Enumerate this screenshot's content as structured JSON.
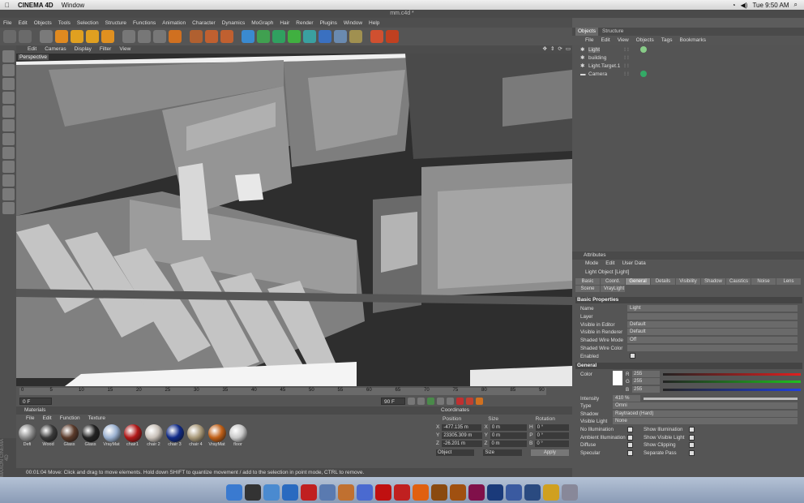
{
  "mac_menu": {
    "app": "CINEMA 4D",
    "items": [
      "Window"
    ],
    "clock": "Tue 9:50 AM"
  },
  "window_title": "mm.c4d *",
  "menubar": [
    "File",
    "Edit",
    "Objects",
    "Tools",
    "Selection",
    "Structure",
    "Functions",
    "Animation",
    "Character",
    "Dynamics",
    "MoGraph",
    "Hair",
    "Render",
    "Plugins",
    "Window",
    "Help"
  ],
  "toolbar_icons": [
    "undo-icon",
    "redo-icon",
    "live-select-icon",
    "move-icon",
    "scale-icon",
    "rotate-icon",
    "world-axis-icon",
    "x-axis-icon",
    "y-axis-icon",
    "z-axis-icon",
    "coordinate-system-icon",
    "render-view-icon",
    "render-picture-viewer-icon",
    "render-settings-icon",
    "cube-icon",
    "nurbs-icon",
    "array-icon",
    "deformer-icon",
    "scene-icon",
    "floor-icon",
    "camera-icon",
    "light-icon",
    "brush-icon",
    "record-icon"
  ],
  "viewport": {
    "menu": [
      "Edit",
      "Cameras",
      "Display",
      "Filter",
      "View"
    ],
    "label": "Perspective"
  },
  "timeline": {
    "ticks": [
      "0",
      "5",
      "10",
      "15",
      "20",
      "25",
      "30",
      "35",
      "40",
      "45",
      "50",
      "55",
      "60",
      "65",
      "70",
      "75",
      "80",
      "85",
      "90"
    ],
    "start": "0 F",
    "end": "90 F",
    "current": "0 F",
    "min_field": "0 F"
  },
  "materials": {
    "title": "Materials",
    "menu": [
      "File",
      "Edit",
      "Function",
      "Texture"
    ],
    "items": [
      {
        "name": "Defi",
        "color": "#8a8a8a"
      },
      {
        "name": "Wood",
        "color": "#3a3a3a"
      },
      {
        "name": "Glass",
        "color": "#5a3a2a"
      },
      {
        "name": "Glass",
        "color": "#222"
      },
      {
        "name": "VrayMat",
        "color": "#9ab0d0"
      },
      {
        "name": "chair1",
        "color": "#b01818"
      },
      {
        "name": "chair 2",
        "color": "#c8c0b8"
      },
      {
        "name": "chair 3",
        "color": "#102a88"
      },
      {
        "name": "chair 4",
        "color": "#a89878"
      },
      {
        "name": "VrayMat",
        "color": "#c06018"
      },
      {
        "name": "floor",
        "color": "#c8c8c8"
      }
    ]
  },
  "coordinates": {
    "title": "Coordinates",
    "headers": [
      "Position",
      "Size",
      "Rotation"
    ],
    "rows": [
      {
        "axis": "X",
        "pos": "-477.135 m",
        "size_axis": "X",
        "size": "0 m",
        "rot_axis": "H",
        "rot": "0 °"
      },
      {
        "axis": "Y",
        "pos": "23305.309 m",
        "size_axis": "Y",
        "size": "0 m",
        "rot_axis": "P",
        "rot": "0 °"
      },
      {
        "axis": "Z",
        "pos": "-26.201 m",
        "size_axis": "Z",
        "size": "0 m",
        "rot_axis": "B",
        "rot": "0 °"
      }
    ],
    "mode": "Object",
    "size_mode": "Size",
    "apply": "Apply"
  },
  "status": "00:01:04  Move: Click and drag to move elements. Hold down SHIFT to quantize movement / add to the selection in point mode, CTRL to remove.",
  "brand": "MAXON CINEMA 4D",
  "objects": {
    "tabs": [
      "Objects",
      "Structure"
    ],
    "menu": [
      "File",
      "Edit",
      "View",
      "Objects",
      "Tags",
      "Bookmarks"
    ],
    "list": [
      {
        "name": "Light",
        "indent": 0,
        "selected": true
      },
      {
        "name": "building",
        "indent": 0,
        "selected": false
      },
      {
        "name": "Light.Target.1",
        "indent": 0,
        "selected": false
      },
      {
        "name": "Camera",
        "indent": 0,
        "selected": false
      }
    ]
  },
  "attributes": {
    "title": "Attributes",
    "menu": [
      "Mode",
      "Edit",
      "User Data"
    ],
    "object_title": "Light Object [Light]",
    "tabs": [
      "Basic",
      "Coord.",
      "General",
      "Details",
      "Visibility",
      "Shadow",
      "Caustics",
      "Noise",
      "Lens",
      "Scene",
      "VrayLight"
    ],
    "active_tab": "General",
    "basic_title": "Basic Properties",
    "basic": [
      {
        "label": "Name",
        "value": "Light"
      },
      {
        "label": "Layer",
        "value": ""
      },
      {
        "label": "Visible in Editor",
        "value": "Default"
      },
      {
        "label": "Visible in Renderer",
        "value": "Default"
      },
      {
        "label": "Shaded Wire Mode",
        "value": "Off"
      },
      {
        "label": "Shaded Wire Color",
        "value": ""
      },
      {
        "label": "Enabled",
        "value": ""
      }
    ],
    "general_title": "General",
    "color_label": "Color",
    "rgb": [
      {
        "ch": "R",
        "val": "255"
      },
      {
        "ch": "G",
        "val": "255"
      },
      {
        "ch": "B",
        "val": "255"
      }
    ],
    "general": [
      {
        "label": "Intensity",
        "value": "410 %"
      },
      {
        "label": "Type",
        "value": "Omni"
      },
      {
        "label": "Shadow",
        "value": "Raytraced (Hard)"
      },
      {
        "label": "Visible Light",
        "value": "None"
      }
    ],
    "checks_left": [
      "No Illumination",
      "Ambient Illumination",
      "Diffuse",
      "Specular"
    ],
    "checks_right": [
      "Show Illumination",
      "Show Visible Light",
      "Show Clipping",
      "Separate Pass"
    ]
  },
  "dock": [
    "Finder",
    "Dashboard",
    "Mail",
    "Safari",
    "iCal",
    "Preview",
    "Photo",
    "iTunes",
    "Flash",
    "Acrobat",
    "Firefox",
    "Bridge",
    "Illustrator",
    "InDesign",
    "Photoshop",
    "Keyboard",
    "Sys",
    "Warn",
    "Trash"
  ]
}
